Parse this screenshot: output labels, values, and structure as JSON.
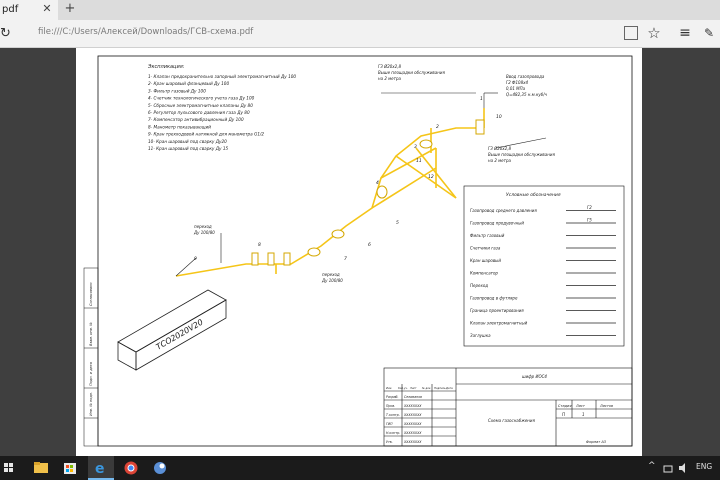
{
  "browser": {
    "tab_title": "pdf",
    "tab_close": "✕",
    "tab_new": "+",
    "url": "file:///C:/Users/Алексей/Downloads/ГСВ-схема.pdf",
    "reload_icon": "reload-icon",
    "star_icon": "star-icon",
    "more_icon": "more-icon"
  },
  "drawing": {
    "legend_title": "Экспликация:",
    "legend_items": [
      "1- Клапан предохранительно запорный электромагнитный Ду 100",
      "2- Кран шаровый фланцевый Ду 100",
      "3- Фильтр газовый Ду 100",
      "4- Счетчик технологического учета газа Ду 100",
      "5- Сбросные электромагнитные клапаны Ду 80",
      "6- Регулятор пульсового давления газа Ду 80",
      "7- Компенсатор антивибрационный Ду 100",
      "8- Манометр показывающий",
      "9- Кран трехходовой натяжной для манометра G1/2",
      "10- Кран шаровый под сварку Ду20",
      "11- Кран шаровый под сварку Ду 15"
    ],
    "note_top": [
      "ГЗ Ø20х2,8",
      "Выше площадки обслуживания",
      "на 2 метра"
    ],
    "note_entry": [
      "Ввод газопровода",
      "Г2 Ф108х4",
      "0,01 МПа",
      "Q=482,35 н.м.куб/ч"
    ],
    "note_right": [
      "ГЗ Ø20х2,8",
      "Выше площадки обслуживания",
      "на 2 метра"
    ],
    "label_transition_1": [
      "переход",
      "Ду 100/80"
    ],
    "label_transition_2": [
      "переход",
      "Ду 100/80"
    ],
    "unit_model": "ТСО2020V20",
    "pipe_numbers": [
      "1",
      "2",
      "3",
      "4",
      "5",
      "6",
      "7",
      "8",
      "9",
      "10",
      "11",
      "12"
    ],
    "symbols_title": "Условные обозначения",
    "symbols": [
      {
        "label": "Газопровод среднего давления",
        "code": "Г2"
      },
      {
        "label": "Газопровод продувочный",
        "code": "Г5"
      },
      {
        "label": "Фильтр газовый",
        "code": ""
      },
      {
        "label": "Счетчики газа",
        "code": ""
      },
      {
        "label": "Кран шаровый",
        "code": ""
      },
      {
        "label": "Компенсатор",
        "code": ""
      },
      {
        "label": "Переход",
        "code": ""
      },
      {
        "label": "Газопровод в футляре",
        "code": ""
      },
      {
        "label": "Граница проектирования",
        "code": ""
      },
      {
        "label": "Клапан электромагнитный",
        "code": ""
      },
      {
        "label": "Заглушка",
        "code": ""
      }
    ],
    "stamp": {
      "code": "шифр ИОС4",
      "stage_h": "Стадия",
      "sheet_h": "Лист",
      "sheets_h": "Листов",
      "stage": "П",
      "sheet": "1",
      "title": "Схема газоснабжения",
      "format": "Формат А3",
      "rows": [
        {
          "role": "Разраб.",
          "name": "Селиванов"
        },
        {
          "role": "Пров.",
          "name": "ХХХХХХХХ"
        },
        {
          "role": "Т.контр.",
          "name": "ХХХХХХХХ"
        },
        {
          "role": "ГИП",
          "name": "ХХХХХХХХ"
        },
        {
          "role": "Н.контр.",
          "name": "ХХХХХХХХ"
        },
        {
          "role": "Утв.",
          "name": "ХХХХХХХХ"
        }
      ],
      "header_cols": [
        "Изм.",
        "Кол.уч.",
        "Лист",
        "№ док.",
        "Подпись",
        "Дата"
      ]
    },
    "side_labels": [
      "Согласовано",
      "Взам. инв. №",
      "Подп. и дата",
      "Инв. № подл."
    ]
  },
  "taskbar": {
    "tray_text": "ENG",
    "tray_up": "^"
  }
}
